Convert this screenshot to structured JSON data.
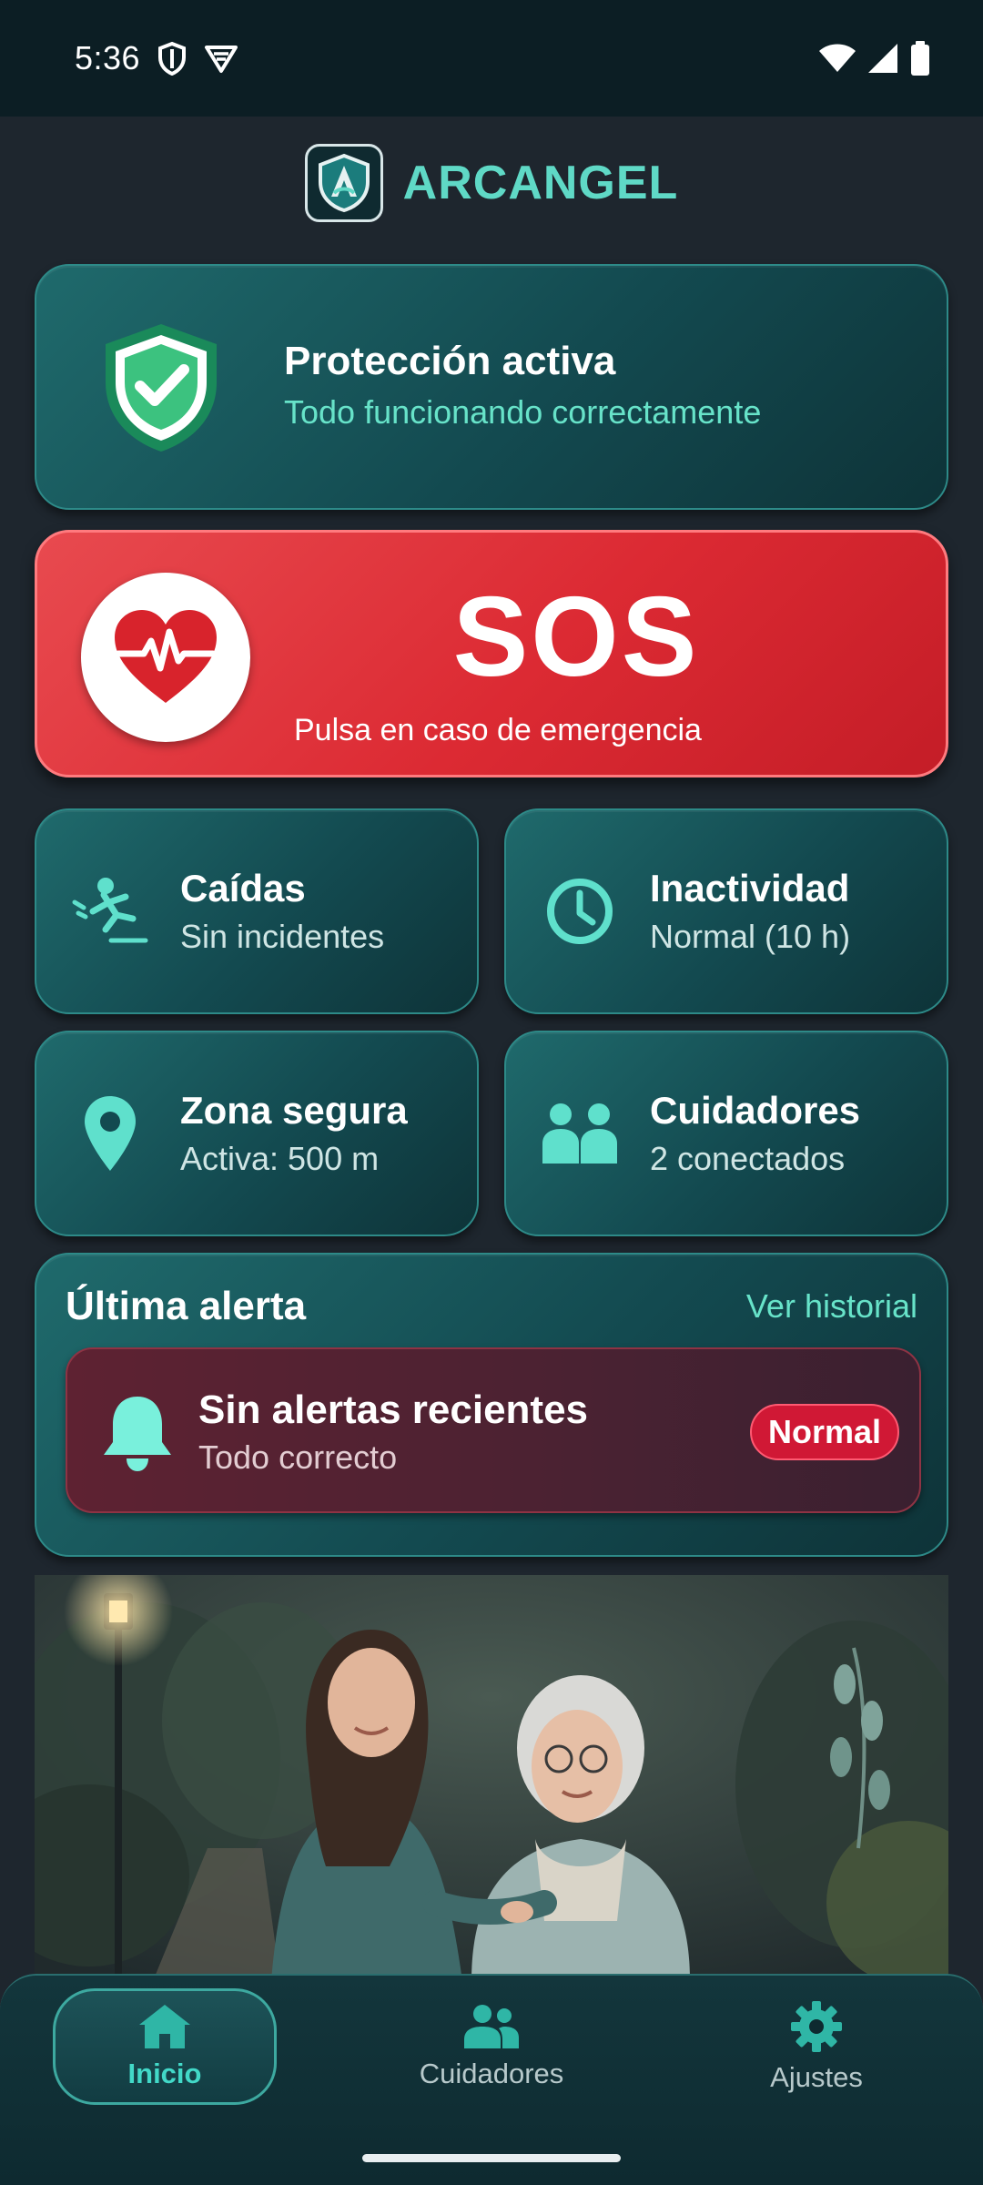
{
  "status_bar": {
    "time": "5:36",
    "icons": [
      "shield-icon",
      "vpn-icon",
      "wifi-icon",
      "signal-icon",
      "battery-icon"
    ]
  },
  "header": {
    "title": "ARCANGEL",
    "logo": "arcangel-logo"
  },
  "protection": {
    "title": "Protección activa",
    "subtitle": "Todo funcionando correctamente",
    "icon": "shield-check-icon"
  },
  "sos": {
    "title": "SOS",
    "subtitle": "Pulsa en caso de emergencia",
    "icon": "heart-pulse-icon"
  },
  "status_cards": [
    {
      "title": "Caídas",
      "subtitle": "Sin incidentes",
      "icon": "fall-icon"
    },
    {
      "title": "Inactividad",
      "subtitle": "Normal (10 h)",
      "icon": "clock-icon"
    },
    {
      "title": "Zona segura",
      "subtitle": "Activa: 500 m",
      "icon": "location-pin-icon"
    },
    {
      "title": "Cuidadores",
      "subtitle": "2 conectados",
      "icon": "people-icon"
    }
  ],
  "last_alert": {
    "heading": "Última alerta",
    "link": "Ver historial",
    "title": "Sin alertas recientes",
    "subtitle": "Todo correcto",
    "badge": "Normal",
    "icon": "bell-icon"
  },
  "bottom_nav": {
    "items": [
      {
        "label": "Inicio",
        "icon": "home-icon",
        "active": true
      },
      {
        "label": "Cuidadores",
        "icon": "people-icon",
        "active": false
      },
      {
        "label": "Ajustes",
        "icon": "gear-icon",
        "active": false
      }
    ]
  },
  "colors": {
    "accent": "#5fd9c6",
    "sos": "#dc2a33",
    "badge": "#d01835",
    "background": "#1e262e"
  }
}
